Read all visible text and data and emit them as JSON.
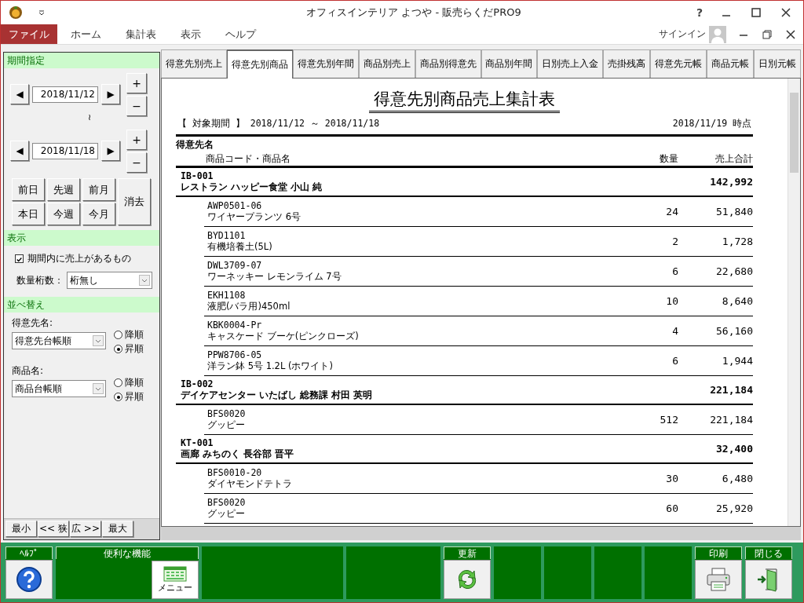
{
  "window": {
    "title": "オフィスインテリア よつや - 販売らくだPRO9",
    "help": "?"
  },
  "menu": [
    {
      "label": "ファイル",
      "selected": true
    },
    {
      "label": "ホーム",
      "selected": false
    },
    {
      "label": "集計表",
      "selected": false
    },
    {
      "label": "表示",
      "selected": false
    },
    {
      "label": "ヘルプ",
      "selected": false
    }
  ],
  "signin": "サインイン",
  "period": {
    "header": "期間指定",
    "start": "2018/11/12",
    "end": "2018/11/18",
    "separator": "≀",
    "prev": "◀",
    "next": "▶",
    "plus": "+",
    "minus": "−",
    "quick": [
      "前日",
      "先週",
      "前月",
      "本日",
      "今週",
      "今月"
    ],
    "clear": "消去"
  },
  "display": {
    "header": "表示",
    "checkbox": {
      "label": "期間内に売上があるもの",
      "checked": true
    },
    "digits_label": "数量桁数：",
    "digits_value": "桁無し"
  },
  "sort": {
    "header": "並べ替え",
    "groups": [
      {
        "label": "得意先名:",
        "value": "得意先台帳順",
        "options": [
          {
            "label": "降順",
            "selected": false
          },
          {
            "label": "昇順",
            "selected": true
          }
        ]
      },
      {
        "label": "商品名:",
        "value": "商品台帳順",
        "options": [
          {
            "label": "降順",
            "selected": false
          },
          {
            "label": "昇順",
            "selected": true
          }
        ]
      }
    ]
  },
  "width_buttons": [
    "最小",
    "<< 狭",
    "広 >>",
    "最大"
  ],
  "tabs": [
    {
      "label": "得意先別売上",
      "selected": false
    },
    {
      "label": "得意先別商品",
      "selected": true
    },
    {
      "label": "得意先別年間",
      "selected": false
    },
    {
      "label": "商品別売上",
      "selected": false
    },
    {
      "label": "商品別得意先",
      "selected": false
    },
    {
      "label": "商品別年間",
      "selected": false
    },
    {
      "label": "日別売上入金",
      "selected": false
    },
    {
      "label": "売掛残高",
      "selected": false
    },
    {
      "label": "得意先元帳",
      "selected": false
    },
    {
      "label": "商品元帳",
      "selected": false
    },
    {
      "label": "日別元帳",
      "selected": false
    }
  ],
  "report": {
    "title": "得意先別商品売上集計表",
    "period": "【 対象期間 】 2018/11/12 ～ 2018/11/18",
    "as_of": "2018/11/19 時点",
    "header": {
      "customer": "得意先名",
      "product": "商品コード・商品名",
      "qty": "数量",
      "amount": "売上合計"
    },
    "groups": [
      {
        "code": "IB-001",
        "name": "レストラン ハッピー食堂 小山 純",
        "total": "142,992",
        "items": [
          {
            "code": "AWP0501-06",
            "name": "ワイヤープランツ 6号",
            "qty": "24",
            "amount": "51,840"
          },
          {
            "code": "BYD1101",
            "name": "有機培養土(5L)",
            "qty": "2",
            "amount": "1,728"
          },
          {
            "code": "DWL3709-07",
            "name": "ワーネッキー レモンライム 7号",
            "qty": "6",
            "amount": "22,680"
          },
          {
            "code": "EKH1108",
            "name": "液肥(バラ用)450ml",
            "qty": "10",
            "amount": "8,640"
          },
          {
            "code": "KBK0004-Pr",
            "name": "キャスケード ブーケ(ピンクローズ)",
            "qty": "4",
            "amount": "56,160"
          },
          {
            "code": "PPW8706-05",
            "name": "洋ラン鉢 5号 1.2L (ホワイト)",
            "qty": "6",
            "amount": "1,944"
          }
        ]
      },
      {
        "code": "IB-002",
        "name": "デイケアセンター いたばし 総務課 村田 英明",
        "total": "221,184",
        "items": [
          {
            "code": "BFS0020",
            "name": "グッピー",
            "qty": "512",
            "amount": "221,184"
          }
        ]
      },
      {
        "code": "KT-001",
        "name": "画廊 みちのく 長谷部 晋平",
        "total": "32,400",
        "items": [
          {
            "code": "BFS0010-20",
            "name": "ダイヤモンドテトラ",
            "qty": "30",
            "amount": "6,480"
          },
          {
            "code": "BFS0020",
            "name": "グッピー",
            "qty": "60",
            "amount": "25,920"
          }
        ]
      }
    ]
  },
  "toolbar": [
    {
      "kind": "help",
      "label": "ﾍﾙﾌﾟ"
    },
    {
      "kind": "menu",
      "label": "便利な機能",
      "button": "メニュー"
    },
    {
      "kind": "empty"
    },
    {
      "kind": "empty"
    },
    {
      "kind": "refresh",
      "label": "更新"
    },
    {
      "kind": "empty"
    },
    {
      "kind": "empty"
    },
    {
      "kind": "empty"
    },
    {
      "kind": "empty"
    },
    {
      "kind": "print",
      "label": "印刷"
    },
    {
      "kind": "close",
      "label": "閉じる"
    }
  ]
}
